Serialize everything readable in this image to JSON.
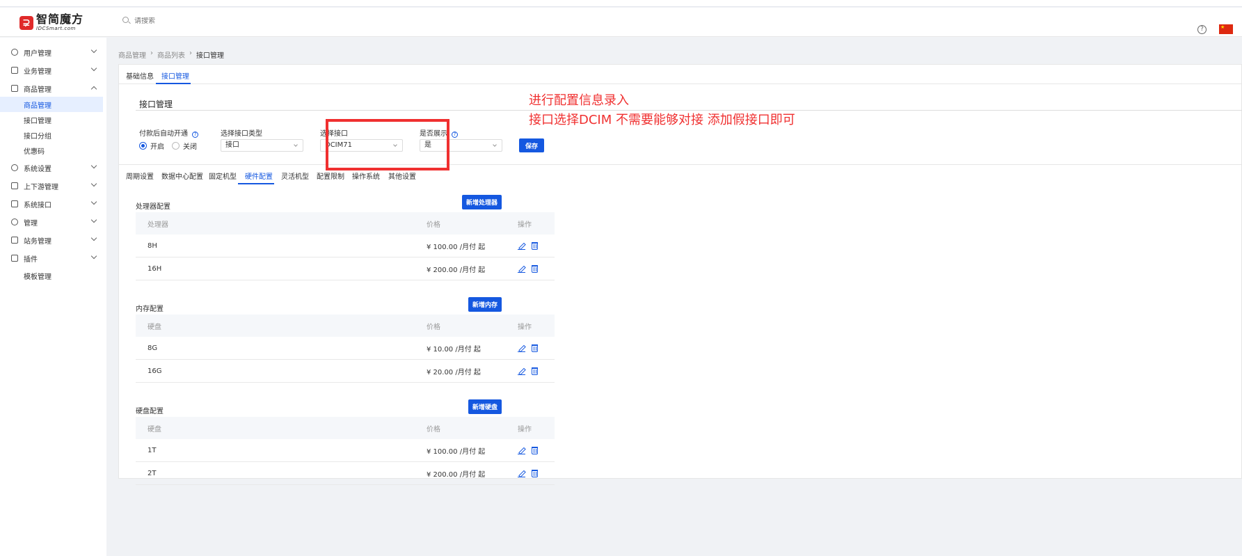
{
  "header": {
    "logo_cn": "智简魔方",
    "logo_en": "IDCSmart.com",
    "search_placeholder": "请搜索",
    "help": "?"
  },
  "sidebar": {
    "items": [
      {
        "label": "用户管理",
        "icon": "user-icon"
      },
      {
        "label": "业务管理",
        "icon": "document-icon"
      },
      {
        "label": "商品管理",
        "icon": "cart-icon"
      },
      {
        "label": "系统设置",
        "icon": "gear-icon"
      },
      {
        "label": "上下游管理",
        "icon": "filter-icon"
      },
      {
        "label": "系统接口",
        "icon": "folder-icon"
      },
      {
        "label": "管理",
        "icon": "sun-icon"
      },
      {
        "label": "站务管理",
        "icon": "monitor-icon"
      },
      {
        "label": "插件",
        "icon": "cube-icon"
      }
    ],
    "sub_goods": [
      "商品管理",
      "接口管理",
      "接口分组",
      "优惠码"
    ],
    "sub_plugin": [
      "模板管理"
    ]
  },
  "breadcrumb": [
    "商品管理",
    "商品列表",
    "接口管理"
  ],
  "top_tabs": [
    "基础信息",
    "接口管理"
  ],
  "section_title": "接口管理",
  "form": {
    "auto_open_label": "付款后自动开通",
    "radio_on": "开启",
    "radio_off": "关闭",
    "type_label": "选择接口类型",
    "type_value": "接口",
    "iface_label": "选择接口",
    "iface_value": "DCIM71",
    "show_label": "是否展示",
    "show_value": "是",
    "save": "保存"
  },
  "annotation": {
    "line1": "进行配置信息录入",
    "line2": "接口选择DCIM  不需要能够对接 添加假接口即可"
  },
  "config_tabs": [
    "周期设置",
    "数据中心配置",
    "固定机型",
    "硬件配置",
    "灵活机型",
    "配置限制",
    "操作系统",
    "其他设置"
  ],
  "groups": [
    {
      "title": "处理器配置",
      "button": "新增处理器",
      "headers": [
        "处理器",
        "价格",
        "操作"
      ],
      "rows": [
        {
          "name": "8H",
          "price": "¥ 100.00 /月付 起"
        },
        {
          "name": "16H",
          "price": "¥ 200.00 /月付 起"
        }
      ]
    },
    {
      "title": "内存配置",
      "button": "新增内存",
      "headers": [
        "硬盘",
        "价格",
        "操作"
      ],
      "rows": [
        {
          "name": "8G",
          "price": "¥ 10.00 /月付 起"
        },
        {
          "name": "16G",
          "price": "¥ 20.00 /月付 起"
        }
      ]
    },
    {
      "title": "硬盘配置",
      "button": "新增硬盘",
      "headers": [
        "硬盘",
        "价格",
        "操作"
      ],
      "rows": [
        {
          "name": "1T",
          "price": "¥ 100.00 /月付 起"
        },
        {
          "name": "2T",
          "price": "¥ 200.00 /月付 起"
        }
      ]
    }
  ]
}
